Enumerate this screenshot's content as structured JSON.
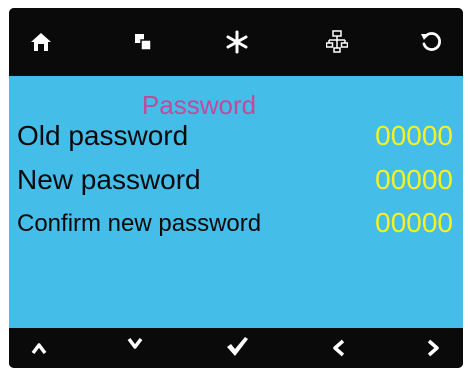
{
  "toolbar": {
    "icons": [
      "home-icon",
      "copy-icon",
      "asterisk-icon",
      "network-icon",
      "refresh-icon"
    ]
  },
  "screen": {
    "title": "Password",
    "rows": [
      {
        "label": "Old password",
        "value": "00000"
      },
      {
        "label": "New password",
        "value": "00000"
      },
      {
        "label": "Confirm new password",
        "value": "00000"
      }
    ]
  },
  "navbar": {
    "icons": [
      "up-icon",
      "down-icon",
      "check-icon",
      "left-icon",
      "right-icon"
    ]
  },
  "colors": {
    "background": "#45bde9",
    "bar": "#0a0a0a",
    "title": "#bf4b9c",
    "value": "#f6f21f",
    "label": "#0a0a0a",
    "icon": "#ffffff"
  }
}
